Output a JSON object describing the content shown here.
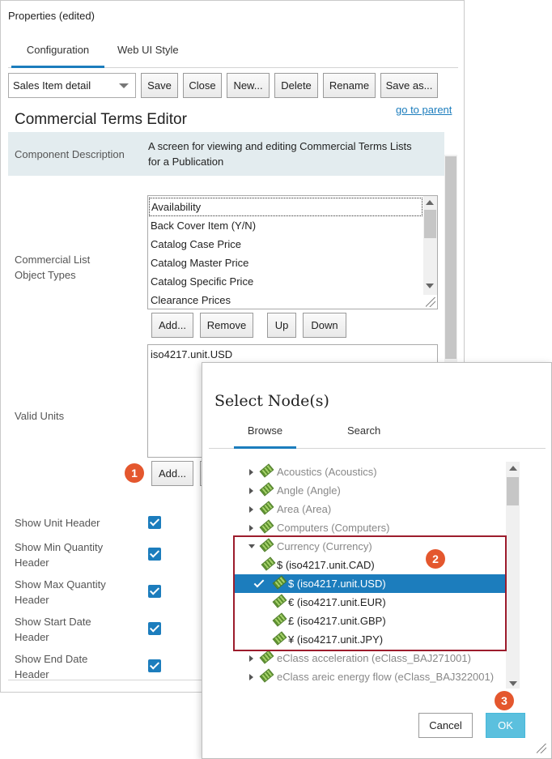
{
  "panel": {
    "title": "Properties (edited)",
    "tabs": [
      {
        "label": "Configuration",
        "active": true
      },
      {
        "label": "Web UI Style",
        "active": false
      }
    ],
    "toolbar": {
      "select_value": "Sales Item detail",
      "buttons": [
        "Save",
        "Close",
        "New...",
        "Delete",
        "Rename",
        "Save as..."
      ]
    },
    "link": "go to parent",
    "heading": "Commercial Terms Editor",
    "component_description": {
      "label": "Component Description",
      "value_line1": "A screen for viewing and editing Commercial Terms Lists",
      "value_line2": "for a Publication"
    },
    "object_types": {
      "label_line1": "Commercial List",
      "label_line2": "Object Types",
      "items": [
        "Availability",
        "Back Cover Item (Y/N)",
        "Catalog Case Price",
        "Catalog Master Price",
        "Catalog Specific Price",
        "Clearance Prices"
      ],
      "buttons": [
        "Add...",
        "Remove",
        "Up",
        "Down"
      ]
    },
    "valid_units": {
      "label": "Valid Units",
      "value": "iso4217.unit.USD",
      "add_button": "Add..."
    },
    "checkboxes": [
      {
        "line1": "Show Unit Header",
        "line2": "",
        "checked": true
      },
      {
        "line1": "Show Min Quantity",
        "line2": "Header",
        "checked": true
      },
      {
        "line1": "Show Max Quantity",
        "line2": "Header",
        "checked": true
      },
      {
        "line1": "Show Start Date",
        "line2": "Header",
        "checked": true
      },
      {
        "line1": "Show End Date",
        "line2": "Header",
        "checked": true
      }
    ]
  },
  "dialog": {
    "title": "Select Node(s)",
    "tabs": [
      {
        "label": "Browse",
        "active": true
      },
      {
        "label": "Search",
        "active": false
      }
    ],
    "tree": [
      {
        "label": "Acoustics (Acoustics)",
        "level": 0,
        "state": "collapsed"
      },
      {
        "label": "Angle (Angle)",
        "level": 0,
        "state": "collapsed"
      },
      {
        "label": "Area (Area)",
        "level": 0,
        "state": "collapsed"
      },
      {
        "label": "Computers (Computers)",
        "level": 0,
        "state": "collapsed"
      },
      {
        "label": "Currency (Currency)",
        "level": 0,
        "state": "expanded"
      },
      {
        "label": "$ (iso4217.unit.CAD)",
        "level": 1,
        "state": "leaf"
      },
      {
        "label": "$ (iso4217.unit.USD)",
        "level": 1,
        "state": "selected"
      },
      {
        "label": "€ (iso4217.unit.EUR)",
        "level": 1,
        "state": "leaf"
      },
      {
        "label": "£ (iso4217.unit.GBP)",
        "level": 1,
        "state": "leaf"
      },
      {
        "label": "¥ (iso4217.unit.JPY)",
        "level": 1,
        "state": "leaf"
      },
      {
        "label": "eClass acceleration (eClass_BAJ271001)",
        "level": 0,
        "state": "collapsed"
      },
      {
        "label": "eClass areic energy flow (eClass_BAJ322001)",
        "level": 0,
        "state": "collapsed"
      }
    ],
    "cancel_label": "Cancel",
    "ok_label": "OK"
  },
  "badges": [
    "1",
    "2",
    "3"
  ],
  "colors": {
    "accent": "#1c7dbd",
    "badge": "#e4572e",
    "highlight_border": "#9c1c2c",
    "ok_button": "#5bc0de"
  }
}
